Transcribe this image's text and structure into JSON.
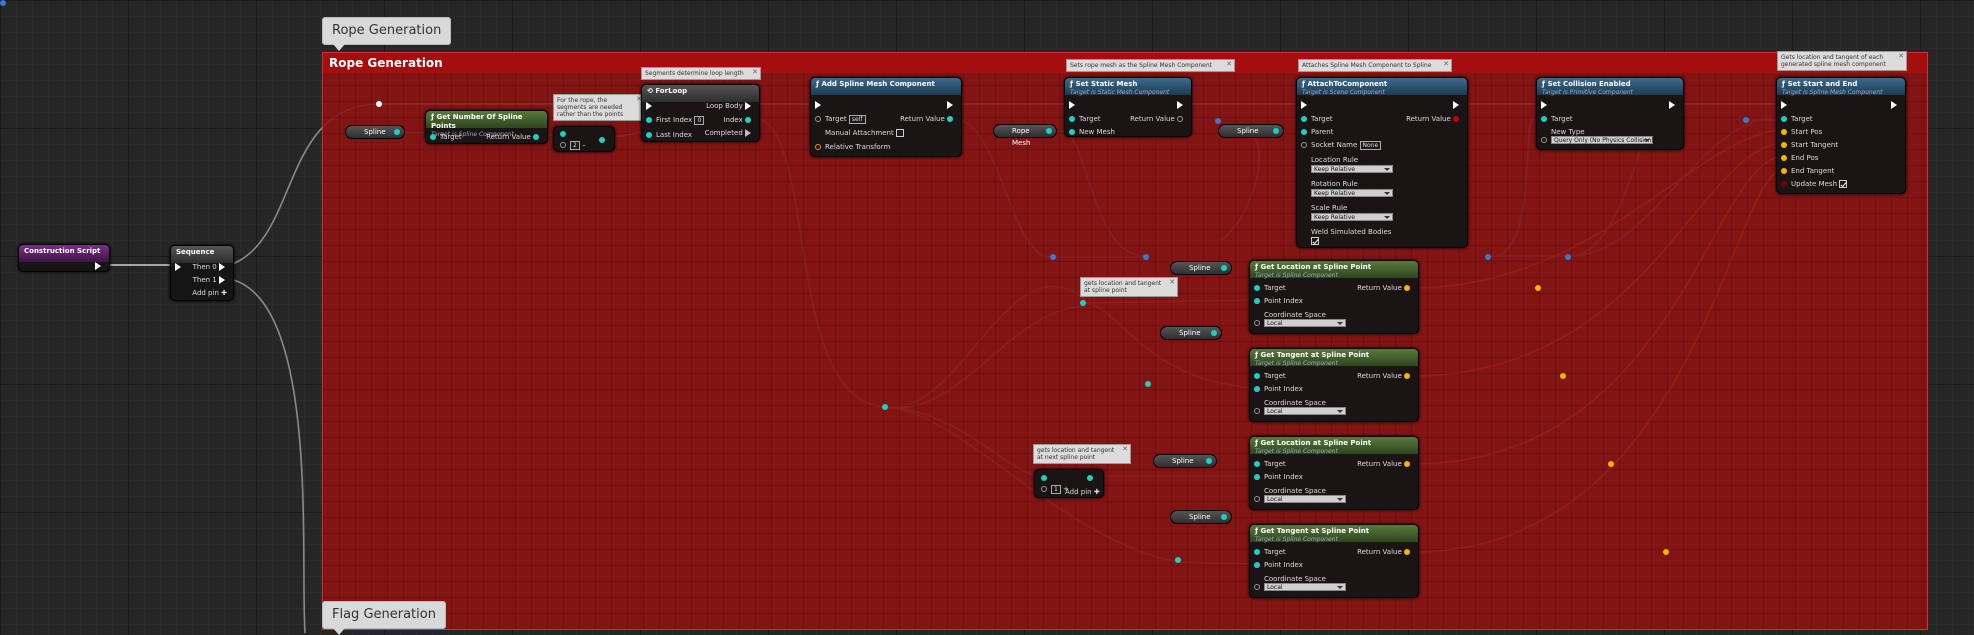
{
  "groups": {
    "rope": {
      "bubble": "Rope Generation",
      "title": "Rope Generation"
    },
    "flag": {
      "bubble": "Flag Generation"
    }
  },
  "construction_script": {
    "title": "Construction Script"
  },
  "sequence": {
    "title": "Sequence",
    "pins": [
      "Then 0",
      "Then 1"
    ],
    "add_pin": "Add pin"
  },
  "get_num_points": {
    "title": "Get Number Of Spline Points",
    "subtitle": "Target is Spline Component",
    "in": "Target",
    "out": "Return Value"
  },
  "minus_node": {
    "value": "2"
  },
  "for_loop": {
    "title": "ForLoop",
    "comment": "Segments determine loop length",
    "in": [
      "First Index",
      "Last Index"
    ],
    "first_index_value": "0",
    "out": [
      "Loop Body",
      "Index",
      "Completed"
    ]
  },
  "rope_note": {
    "text": "For the rope, the segments are needed rather than the points"
  },
  "add_spline_mesh": {
    "title": "Add Spline Mesh Component",
    "target": "Target",
    "target_value": "self",
    "manual": "Manual Attachment",
    "relative": "Relative Transform",
    "out": "Return Value"
  },
  "set_static_mesh": {
    "title": "Set Static Mesh",
    "subtitle": "Target is Static Mesh Component",
    "comment": "Sets rope mesh as the Spline Mesh Component",
    "in": [
      "Target",
      "New Mesh"
    ],
    "out": "Return Value"
  },
  "attach": {
    "title": "AttachToComponent",
    "subtitle": "Target is Scene Component",
    "comment": "Attaches Spline Mesh Component to Spline",
    "in": [
      "Target",
      "Parent",
      "Socket Name",
      "Location Rule",
      "Rotation Rule",
      "Scale Rule",
      "Weld Simulated Bodies"
    ],
    "socket_value": "None",
    "rule_value": "Keep Relative",
    "out": "Return Value"
  },
  "set_collision": {
    "title": "Set Collision Enabled",
    "subtitle": "Target is Primitive Component",
    "in": [
      "Target",
      "New Type"
    ],
    "type_value": "Query Only (No Physics Collision)"
  },
  "set_start_end": {
    "title": "Set Start and End",
    "subtitle": "Target is Spline Mesh Component",
    "comment": "Gets location and tangent of each generated spline mesh component",
    "in": [
      "Target",
      "Start Pos",
      "Start Tangent",
      "End Pos",
      "End Tangent",
      "Update Mesh"
    ]
  },
  "variables": {
    "spline": "Spline",
    "rope_mesh": "Rope Mesh"
  },
  "get_location": {
    "title": "Get Location at Spline Point",
    "subtitle": "Target is Spline Component"
  },
  "get_tangent": {
    "title": "Get Tangent at Spline Point",
    "subtitle": "Target is Spline Component"
  },
  "spline_fn_pins": {
    "target": "Target",
    "point_index": "Point Index",
    "coord": "Coordinate Space",
    "coord_value": "Local",
    "out": "Return Value"
  },
  "comments": {
    "loc_tan": "gets location and tangent at spline point",
    "loc_tan_next": "gets location and tangent at next spline point"
  },
  "add_node": {
    "value": "1",
    "add_pin": "Add pin"
  },
  "colors": {
    "comment_bg": "#911212",
    "comment_header": "#a50e0e",
    "object_pin": "#1fd0c0",
    "vector_pin": "#f6b400",
    "function_header": "#3b6a8f",
    "pure_header": "#587a3c"
  }
}
